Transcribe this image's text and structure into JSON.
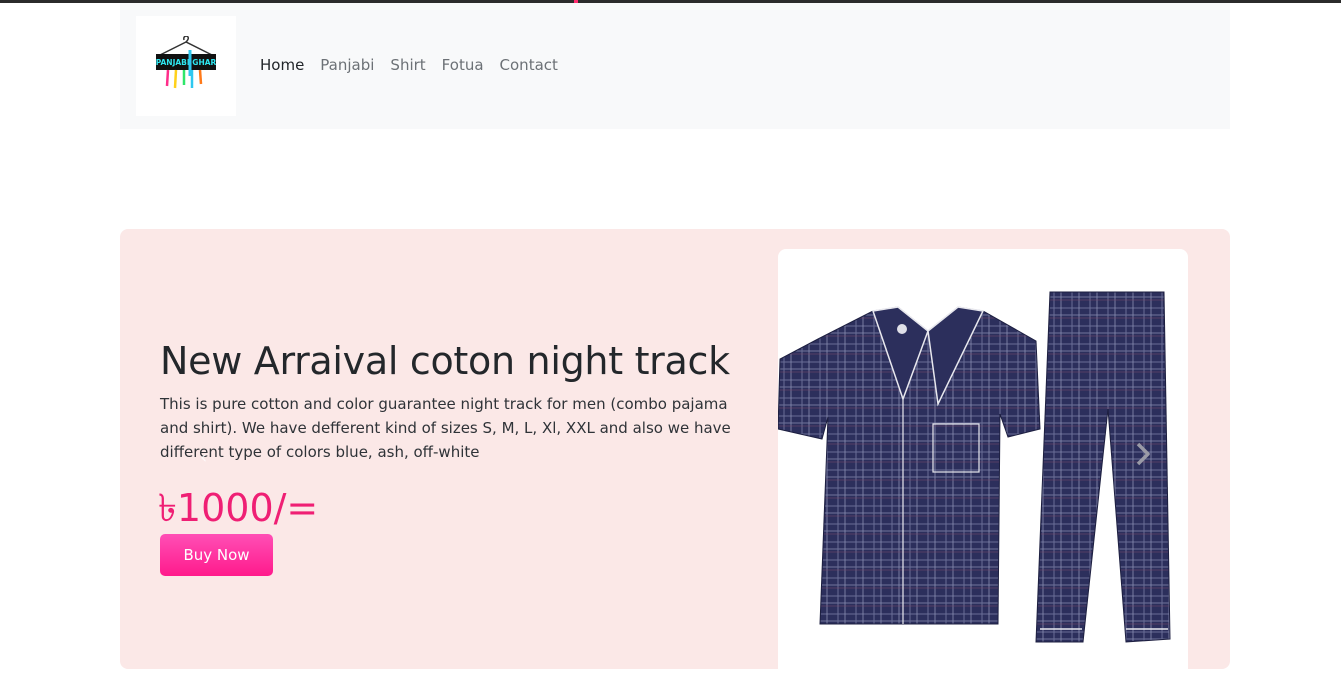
{
  "nav": {
    "logo_text": "PANJABI GHAR",
    "links": [
      "Home",
      "Panjabi",
      "Shirt",
      "Fotua",
      "Contact"
    ],
    "active": "Home"
  },
  "hero": {
    "title": "New Arraival coton night track",
    "description": "This is pure cotton and color guarantee night track for men (combo pajama and shirt). We have defferent kind of sizes S, M, L, Xl, XXL and also we have different type of colors blue, ash, off-white",
    "price": "৳1000/=",
    "buy_label": "Buy Now"
  },
  "colors": {
    "accent": "#ef1f74",
    "button": "#ff1a8c",
    "hero_bg": "#fbe8e7",
    "navbar_bg": "#f8f9fa"
  },
  "icons": {
    "prev": "chevron-left-icon",
    "next": "chevron-right-icon"
  }
}
